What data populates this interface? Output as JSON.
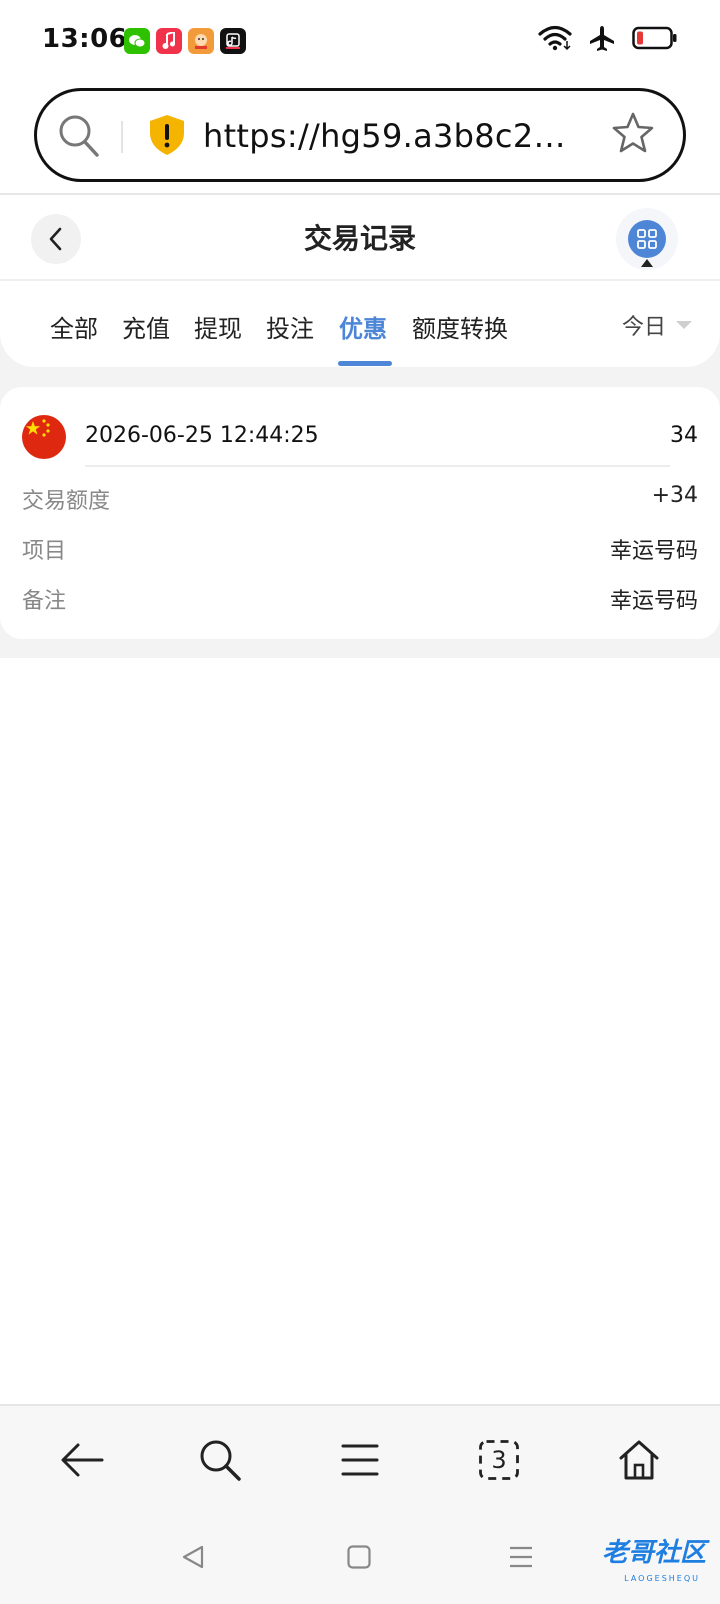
{
  "status_bar": {
    "time": "13:06",
    "app_icons": [
      {
        "name": "wechat-icon",
        "color": "#2dc100"
      },
      {
        "name": "music-icon",
        "color": "#f0334a"
      },
      {
        "name": "game-icon",
        "color": "#f39b3a"
      },
      {
        "name": "video-icon",
        "color": "#111111"
      }
    ],
    "icons": [
      "wifi-icon",
      "airplane-icon",
      "battery-icon"
    ],
    "battery_color": "#e53935"
  },
  "browser": {
    "url": "https://hg59.a3b8c2d9e...",
    "shield_color": "#f5b400"
  },
  "header": {
    "title": "交易记录"
  },
  "tabs": {
    "items": [
      {
        "label": "全部",
        "active": false
      },
      {
        "label": "充值",
        "active": false
      },
      {
        "label": "提现",
        "active": false
      },
      {
        "label": "投注",
        "active": false
      },
      {
        "label": "优惠",
        "active": true
      },
      {
        "label": "额度转换",
        "active": false
      }
    ],
    "date_filter": "今日",
    "accent_color": "#4d86d6"
  },
  "records": [
    {
      "datetime": "2026-06-25 12:44:25",
      "amount": "34",
      "rows": [
        {
          "label": "交易额度",
          "value": "+34"
        },
        {
          "label": "项目",
          "value": "幸运号码"
        },
        {
          "label": "备注",
          "value": "幸运号码"
        }
      ]
    }
  ],
  "bottom_nav": {
    "tab_count": "3",
    "icons": [
      "back-arrow-icon",
      "search-icon",
      "menu-icon",
      "tabs-icon",
      "home-icon"
    ]
  },
  "system_nav": {
    "icons": [
      "back-triangle-icon",
      "home-square-icon",
      "recent-lines-icon"
    ],
    "watermark": "老哥社区",
    "watermark_sub": "LAOGESHEQU"
  }
}
